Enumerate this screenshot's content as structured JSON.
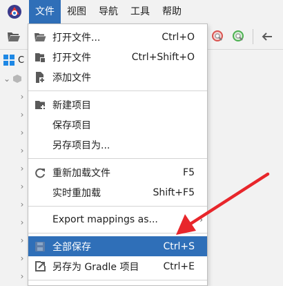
{
  "menubar": {
    "items": [
      {
        "label": "文件",
        "active": true
      },
      {
        "label": "视图",
        "active": false
      },
      {
        "label": "导航",
        "active": false
      },
      {
        "label": "工具",
        "active": false
      },
      {
        "label": "帮助",
        "active": false
      }
    ]
  },
  "tree": {
    "root_label": "C"
  },
  "file_menu": {
    "items": [
      {
        "label": "打开文件...",
        "shortcut": "Ctrl+O",
        "icon": "folder-open-icon"
      },
      {
        "label": "打开文件",
        "shortcut": "Ctrl+Shift+O",
        "icon": "file-open-icon"
      },
      {
        "label": "添加文件",
        "shortcut": "",
        "icon": "file-add-icon"
      },
      {
        "label": "新建项目",
        "shortcut": "",
        "icon": "new-project-icon"
      },
      {
        "label": "保存项目",
        "shortcut": "",
        "icon": ""
      },
      {
        "label": "另存项目为...",
        "shortcut": "",
        "icon": ""
      },
      {
        "label": "重新加载文件",
        "shortcut": "F5",
        "icon": "reload-icon"
      },
      {
        "label": "实时重加载",
        "shortcut": "Shift+F5",
        "icon": ""
      },
      {
        "label": "Export mappings as...",
        "shortcut": "",
        "icon": ""
      },
      {
        "label": "全部保存",
        "shortcut": "Ctrl+S",
        "icon": "save-icon",
        "highlighted": true
      },
      {
        "label": "另存为 Gradle 项目",
        "shortcut": "Ctrl+E",
        "icon": "export-icon"
      }
    ]
  },
  "colors": {
    "accent": "#2f6fb8",
    "annotation_arrow": "#e8262b"
  }
}
